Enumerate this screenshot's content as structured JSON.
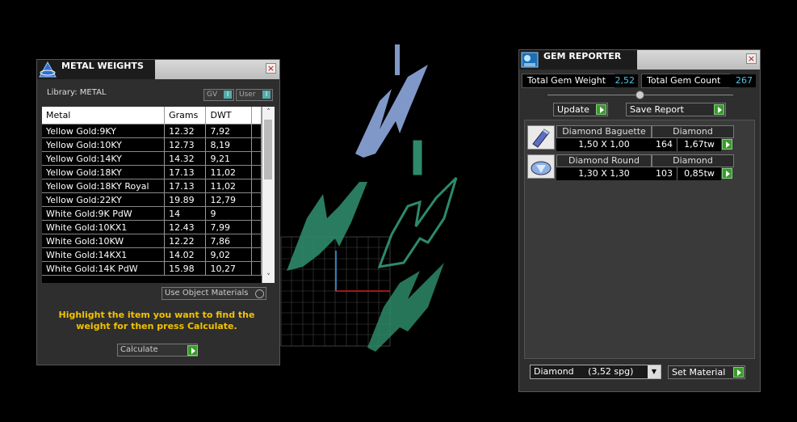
{
  "metal_weights": {
    "title": "METAL WEIGHTS",
    "library_label": "Library: METAL",
    "gv_label": "GV",
    "user_label": "User",
    "columns": [
      "Metal",
      "Grams",
      "DWT"
    ],
    "rows": [
      {
        "metal": "Yellow Gold:9KY",
        "grams": "12.32",
        "dwt": "7,92"
      },
      {
        "metal": "Yellow Gold:10KY",
        "grams": "12.73",
        "dwt": "8,19"
      },
      {
        "metal": "Yellow Gold:14KY",
        "grams": "14.32",
        "dwt": "9,21"
      },
      {
        "metal": "Yellow Gold:18KY",
        "grams": "17.13",
        "dwt": "11,02"
      },
      {
        "metal": "Yellow Gold:18KY Royal",
        "grams": "17.13",
        "dwt": "11,02"
      },
      {
        "metal": "Yellow Gold:22KY",
        "grams": "19.89",
        "dwt": "12,79"
      },
      {
        "metal": "White Gold:9K PdW",
        "grams": "14",
        "dwt": "9"
      },
      {
        "metal": "White Gold:10KX1",
        "grams": "12.43",
        "dwt": "7,99"
      },
      {
        "metal": "White Gold:10KW",
        "grams": "12.22",
        "dwt": "7,86"
      },
      {
        "metal": "White Gold:14KX1",
        "grams": "14.02",
        "dwt": "9,02"
      },
      {
        "metal": "White Gold:14K PdW",
        "grams": "15.98",
        "dwt": "10,27"
      }
    ],
    "use_object_materials": "Use Object Materials",
    "hint": "Highlight the item you want to find the weight for then press Calculate.",
    "calculate_label": "Calculate"
  },
  "gem_reporter": {
    "title": "GEM REPORTER",
    "total_weight_label": "Total Gem Weight",
    "total_weight_value": "2,52",
    "total_count_label": "Total Gem Count",
    "total_count_value": "267",
    "update_label": "Update",
    "save_report_label": "Save Report",
    "gems": [
      {
        "name": "Diamond Baguette",
        "material": "Diamond",
        "size": "1,50 X 1,00",
        "count": "164",
        "weight": "1,67tw",
        "icon": "baguette-gem-icon"
      },
      {
        "name": "Diamond Round",
        "material": "Diamond",
        "size": "1,30 X 1,30",
        "count": "103",
        "weight": "0,85tw",
        "icon": "round-gem-icon"
      }
    ],
    "material_select": "Diamond     (3,52 spg)",
    "set_material_label": "Set Material"
  },
  "colors": {
    "accent_value": "#4fc3e8",
    "hint_text": "#f2c200",
    "play_green": "#3a9a2a",
    "mesh_green": "#3aa37d",
    "gem_blue": "#9fb8e8"
  }
}
